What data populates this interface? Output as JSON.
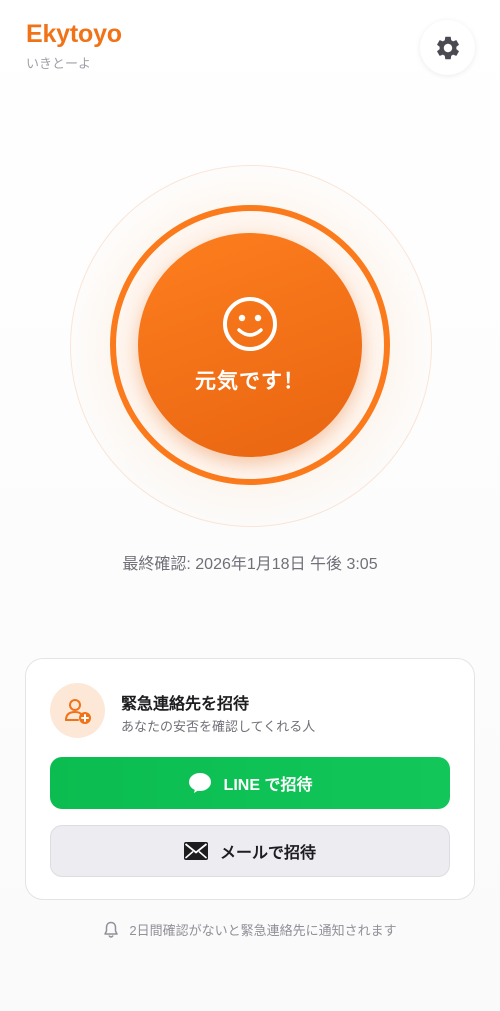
{
  "app": {
    "title": "Ekytoyo",
    "subtitle": "いきとーよ"
  },
  "icons": {
    "settings": "gear-icon",
    "status": "smiley-face-icon",
    "invite": "add-user-icon",
    "line": "chat-bubble-icon",
    "mail": "envelope-icon",
    "notice": "bell-icon"
  },
  "colors": {
    "accent": "#f07318",
    "main_button": "#fb7a1c",
    "line_green": "#0bbd50",
    "muted_text": "#707078"
  },
  "status": {
    "button_label": "元気です！",
    "last_check": "最終確認: 2026年1月18日 午後 3:05"
  },
  "invite_card": {
    "title": "緊急連絡先を招待",
    "description": "あなたの安否を確認してくれる人",
    "line_button": "LINE で招待",
    "mail_button": "メールで招待"
  },
  "footer": {
    "notice": "2日間確認がないと緊急連絡先に通知されます"
  }
}
